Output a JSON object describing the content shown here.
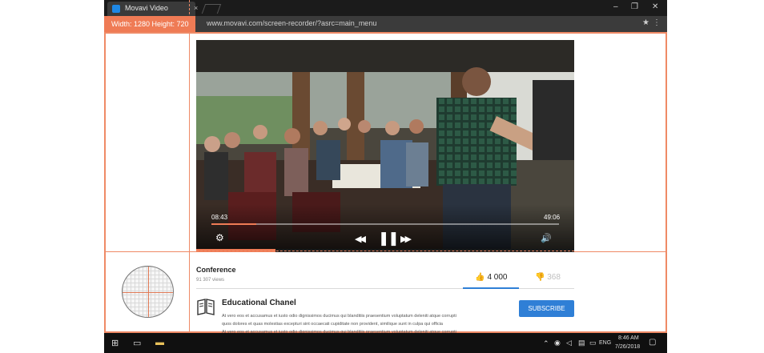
{
  "browser": {
    "tab_title": "Movavi Video",
    "tab_close": "×",
    "url": "www.movavi.com/screen-recorder/?asrc=main_menu",
    "star_icon": "★",
    "menu_icon": "⋮",
    "win_minimize": "–",
    "win_maximize": "❐",
    "win_close": "✕"
  },
  "capture": {
    "dimensions": "Width: 1280  Height: 720"
  },
  "player": {
    "current_time": "08:43",
    "total_time": "49:06",
    "progress": 0.13,
    "buffered": 0.21,
    "settings_icon": "⚙",
    "rewind_icon": "◀◀",
    "pause_icon": "❚❚",
    "forward_icon": "▶▶",
    "volume_icon": "🔊"
  },
  "video": {
    "title": "Conference",
    "views": "91 307 views",
    "likes": "4 000",
    "dislikes": "368"
  },
  "channel": {
    "name": "Educational Chanel",
    "subscribe": "SUBSCRIBE",
    "description": [
      "At vero eos et accusamus et iusto odio dignissimos ducimus qui blanditiis praesentium voluptatum deleniti atque corrupti",
      "quos dolores et quas molestias excepturi sint occaecati cupiditate non provident, similique sunt in culpa qui officia",
      "At vero eos et accusamus et iusto odio dignissimos ducimus qui blanditiis praesentium voluptatum deleniti atque corrupti"
    ]
  },
  "taskbar": {
    "language": "ENG",
    "time": "8:46 AM",
    "date": "7/26/2018"
  },
  "colors": {
    "accent": "#ef7b55",
    "primary": "#2f7fd6"
  }
}
